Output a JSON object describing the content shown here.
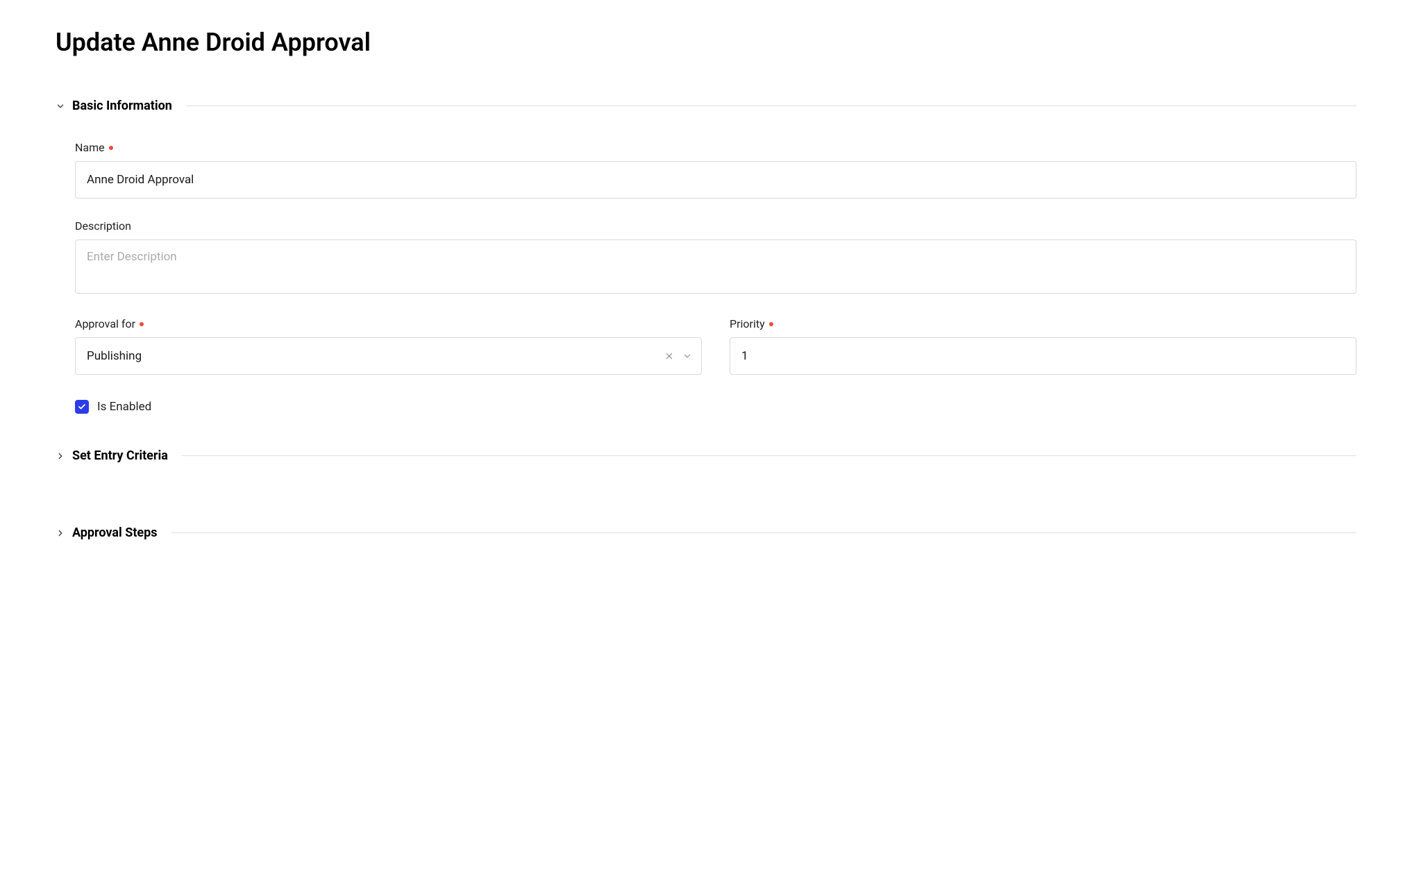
{
  "page": {
    "title": "Update Anne Droid Approval"
  },
  "sections": {
    "basicInfo": {
      "title": "Basic Information",
      "expanded": true,
      "fields": {
        "name": {
          "label": "Name",
          "required": true,
          "value": "Anne Droid Approval"
        },
        "description": {
          "label": "Description",
          "required": false,
          "placeholder": "Enter Description",
          "value": ""
        },
        "approvalFor": {
          "label": "Approval for",
          "required": true,
          "value": "Publishing"
        },
        "priority": {
          "label": "Priority",
          "required": true,
          "value": "1"
        },
        "isEnabled": {
          "label": "Is Enabled",
          "checked": true
        }
      }
    },
    "entryCriteria": {
      "title": "Set Entry Criteria",
      "expanded": false
    },
    "approvalSteps": {
      "title": "Approval Steps",
      "expanded": false
    }
  }
}
